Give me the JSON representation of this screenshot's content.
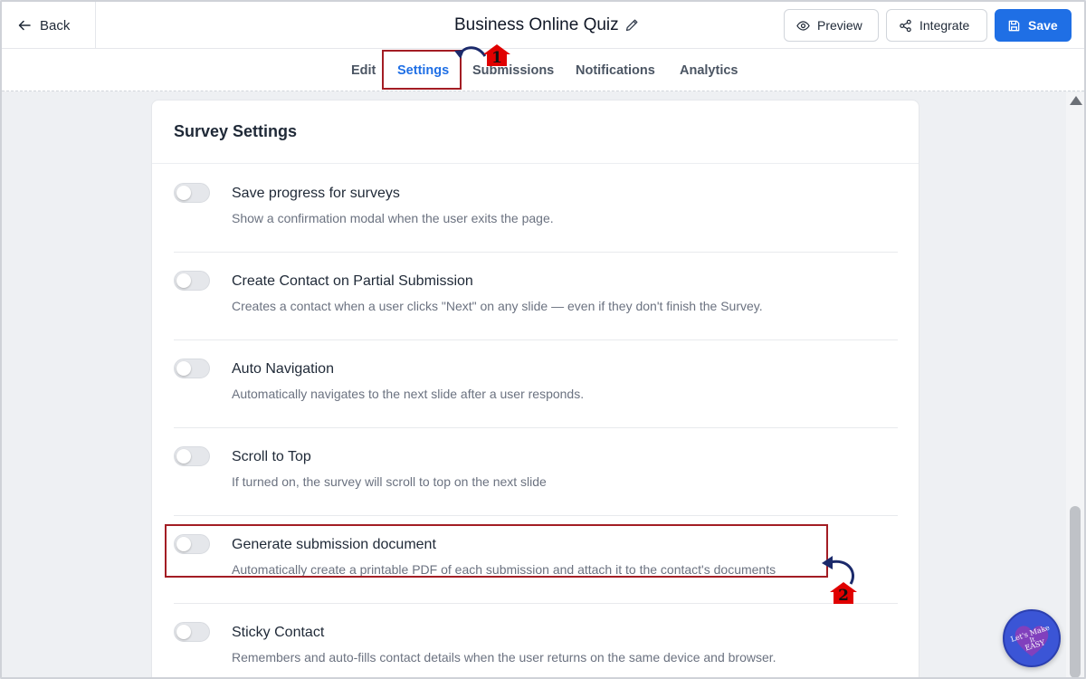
{
  "header": {
    "back_label": "Back",
    "title": "Business Online Quiz",
    "preview_label": "Preview",
    "integrate_label": "Integrate",
    "save_label": "Save"
  },
  "tabs": [
    {
      "label": "Edit",
      "active": false
    },
    {
      "label": "Settings",
      "active": true
    },
    {
      "label": "Submissions",
      "active": false
    },
    {
      "label": "Notifications",
      "active": false
    },
    {
      "label": "Analytics",
      "active": false
    }
  ],
  "card": {
    "title": "Survey Settings",
    "settings": [
      {
        "label": "Save progress for surveys",
        "description": "Show a confirmation modal when the user exits the page.",
        "enabled": false
      },
      {
        "label": "Create Contact on Partial Submission",
        "description": "Creates a contact when a user clicks \"Next\" on any slide — even if they don't finish the Survey.",
        "enabled": false
      },
      {
        "label": "Auto Navigation",
        "description": "Automatically navigates to the next slide after a user responds.",
        "enabled": false
      },
      {
        "label": "Scroll to Top",
        "description": "If turned on, the survey will scroll to top on the next slide",
        "enabled": false
      },
      {
        "label": "Generate submission document",
        "description": "Automatically create a printable PDF of each submission and attach it to the contact's documents",
        "enabled": false
      },
      {
        "label": "Sticky Contact",
        "description": "Remembers and auto-fills contact details when the user returns on the same device and browser.",
        "enabled": false
      }
    ]
  },
  "annotations": {
    "badge_1": "1",
    "badge_2": "2",
    "box_color": "#a31d24",
    "badge_color": "#e00000"
  },
  "colors": {
    "accent": "#1f6fe5"
  },
  "watermark": {
    "text_line1": "Let's Make",
    "text_line2": "It",
    "text_line3": "EASY"
  }
}
